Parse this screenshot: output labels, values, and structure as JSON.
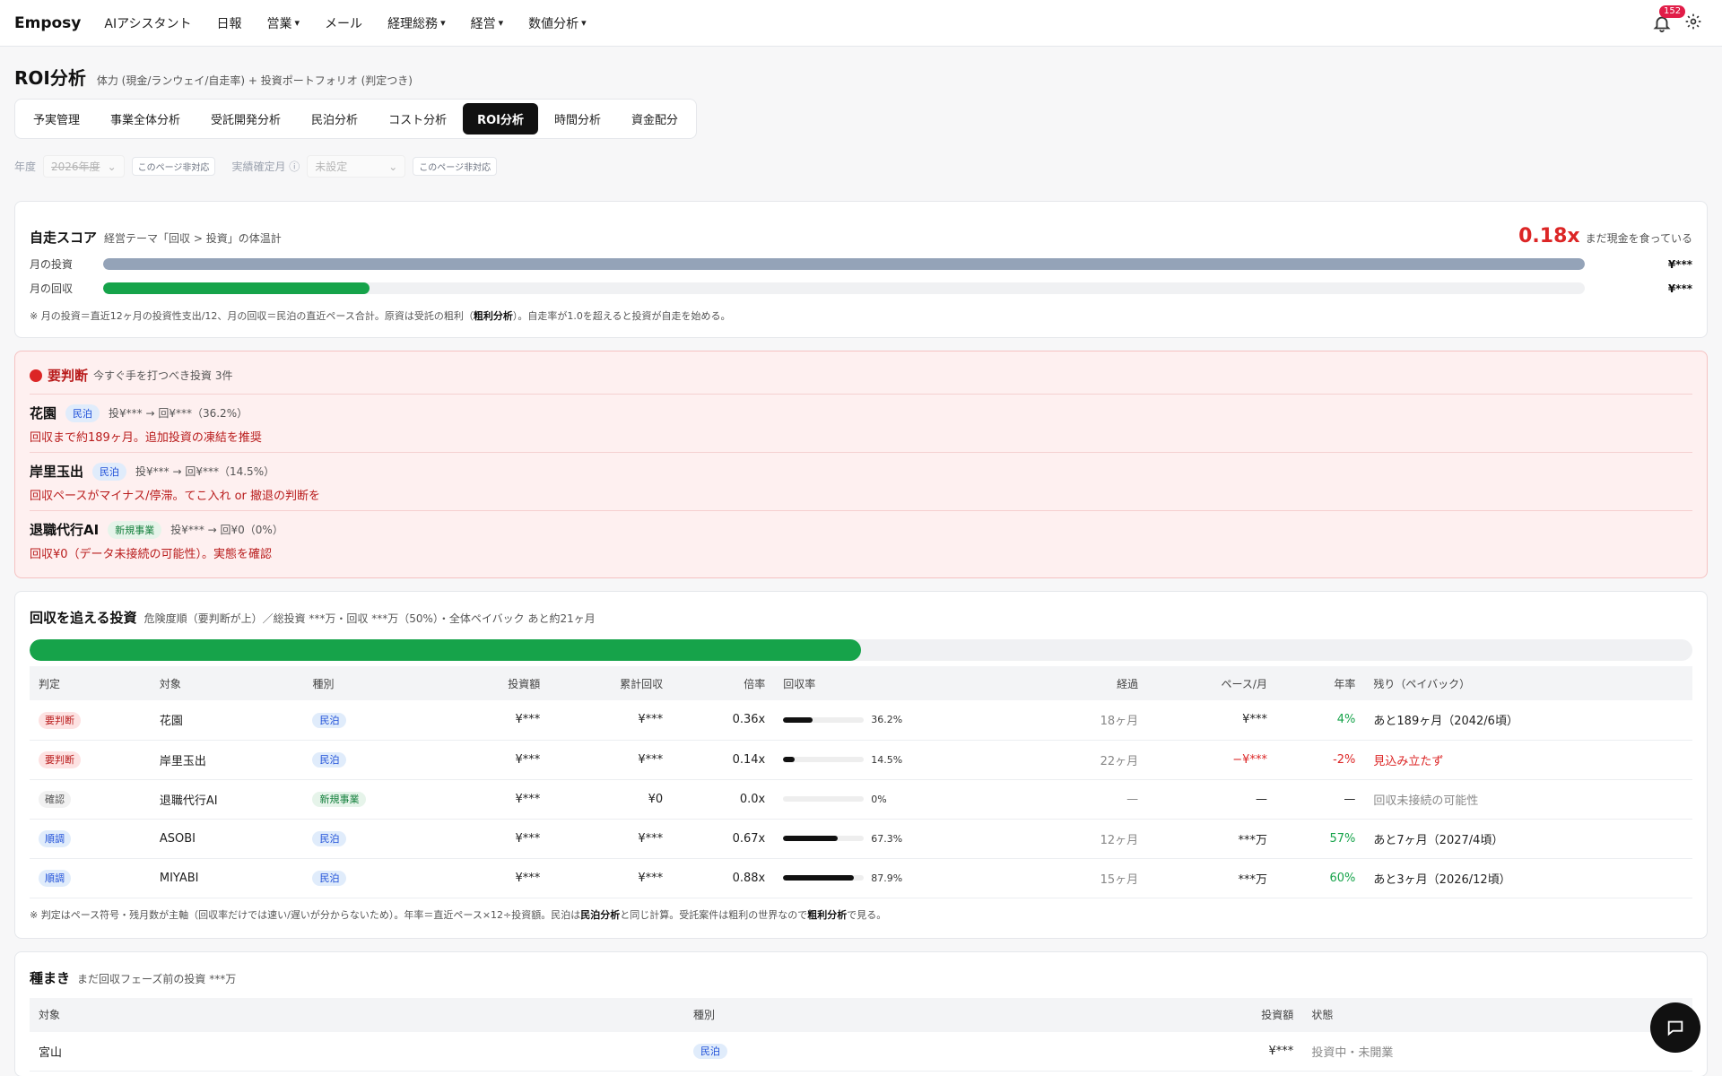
{
  "nav": {
    "brand": "Emposy",
    "items": [
      {
        "label": "AIアシスタント",
        "caret": ""
      },
      {
        "label": "日報",
        "caret": ""
      },
      {
        "label": "営業",
        "caret": "▾"
      },
      {
        "label": "メール",
        "caret": ""
      },
      {
        "label": "経理総務",
        "caret": "▾"
      },
      {
        "label": "経営",
        "caret": "▾"
      },
      {
        "label": "数値分析",
        "caret": "▾"
      }
    ],
    "notifications": "152"
  },
  "header": {
    "title": "ROI分析",
    "subtitle": "体力 (現金/ランウェイ/自走率) + 投資ポートフォリオ (判定つき)"
  },
  "tabs": [
    "予実管理",
    "事業全体分析",
    "受託開発分析",
    "民泊分析",
    "コスト分析",
    "ROI分析",
    "時間分析",
    "資金配分"
  ],
  "active_tab_index": 5,
  "filters": {
    "year_label": "年度",
    "year_value": "2026年度",
    "year_chip": "このページ非対応",
    "confirm_label": "実績確定月",
    "confirm_info": "ⓘ",
    "confirm_value": "未設定",
    "confirm_chip": "このページ非対応"
  },
  "self_score": {
    "title": "自走スコア",
    "subtitle": "経営テーマ「回収 > 投資」の体温計",
    "value": "0.18x",
    "value_label": "まだ現金を食っている",
    "rows": [
      {
        "label": "月の投資",
        "amount": "¥***",
        "fraction": 1.0,
        "color": "#94a3b8"
      },
      {
        "label": "月の回収",
        "amount": "¥***",
        "fraction": 0.18,
        "color": "#16a34a"
      }
    ],
    "note_pre": "※ 月の投資＝直近12ヶ月の投資性支出/12、月の回収＝民泊の直近ペース合計。原資は受託の粗利（",
    "note_bold": "粗利分析",
    "note_post": "）。自走率が1.0を超えると投資が自走を始める。"
  },
  "alert": {
    "title": "要判断",
    "subtitle": "今すぐ手を打つべき投資 3件",
    "items": [
      {
        "name": "花園",
        "tag": "民泊",
        "amount": "投¥*** → 回¥***（36.2%）",
        "message": "回収まで約189ヶ月。追加投資の凍結を推奨"
      },
      {
        "name": "岸里玉出",
        "tag": "民泊",
        "amount": "投¥*** → 回¥***（14.5%）",
        "message": "回収ペースがマイナス/停滞。てこ入れ or 撤退の判断を"
      },
      {
        "name": "退職代行AI",
        "tag": "新規事業",
        "amount": "投¥*** → 回¥0（0%）",
        "message": "回収¥0（データ未接続の可能性）。実態を確認"
      }
    ]
  },
  "recovery": {
    "title": "回収を追える投資",
    "subtitle": "危険度順（要判断が上）／総投資 ***万・回収 ***万（50%）・全体ペイバック あと約21ヶ月",
    "progress": 0.5,
    "columns": [
      "判定",
      "対象",
      "種別",
      "投資額",
      "累計回収",
      "倍率",
      "回収率",
      "経過",
      "ペース/月",
      "年率",
      "残り（ペイバック）"
    ],
    "rows": [
      {
        "judge": "要判断",
        "judge_style": "red",
        "target": "花園",
        "type": "民泊",
        "invest": "¥***",
        "recovered": "¥***",
        "multiple": "0.36x",
        "rate": 0.362,
        "rate_label": "36.2%",
        "elapsed": "18ヶ月",
        "pace": "¥***",
        "pace_style": "",
        "annual": "4%",
        "annual_style": "pos",
        "remaining": "あと189ヶ月（2042/6頃）",
        "remaining_style": ""
      },
      {
        "judge": "要判断",
        "judge_style": "red",
        "target": "岸里玉出",
        "type": "民泊",
        "invest": "¥***",
        "recovered": "¥***",
        "multiple": "0.14x",
        "rate": 0.145,
        "rate_label": "14.5%",
        "elapsed": "22ヶ月",
        "pace": "−¥***",
        "pace_style": "neg",
        "annual": "-2%",
        "annual_style": "neg",
        "remaining": "見込み立たず",
        "remaining_style": "neg"
      },
      {
        "judge": "確認",
        "judge_style": "gray",
        "target": "退職代行AI",
        "type": "新規事業",
        "invest": "¥***",
        "recovered": "¥0",
        "multiple": "0.0x",
        "rate": 0,
        "rate_label": "0%",
        "elapsed": "—",
        "pace": "—",
        "pace_style": "",
        "annual": "—",
        "annual_style": "",
        "remaining": "回収未接続の可能性",
        "remaining_style": "muted"
      },
      {
        "judge": "順調",
        "judge_style": "blue",
        "target": "ASOBI",
        "type": "民泊",
        "invest": "¥***",
        "recovered": "¥***",
        "multiple": "0.67x",
        "rate": 0.673,
        "rate_label": "67.3%",
        "elapsed": "12ヶ月",
        "pace": "***万",
        "pace_style": "",
        "annual": "57%",
        "annual_style": "pos",
        "remaining": "あと7ヶ月（2027/4頃）",
        "remaining_style": ""
      },
      {
        "judge": "順調",
        "judge_style": "blue",
        "target": "MIYABI",
        "type": "民泊",
        "invest": "¥***",
        "recovered": "¥***",
        "multiple": "0.88x",
        "rate": 0.879,
        "rate_label": "87.9%",
        "elapsed": "15ヶ月",
        "pace": "***万",
        "pace_style": "",
        "annual": "60%",
        "annual_style": "pos",
        "remaining": "あと3ヶ月（2026/12頃）",
        "remaining_style": ""
      }
    ],
    "note_1": "※ 判定はペース符号・残月数が主軸（回収率だけでは速い/遅いが分からないため）。年率＝直近ペース×12÷投資額。民泊は",
    "note_bold_1": "民泊分析",
    "note_2": "と同じ計算。受託案件は粗利の世界なので",
    "note_bold_2": "粗利分析",
    "note_3": "で見る。"
  },
  "seeding": {
    "title": "種まき",
    "subtitle": "まだ回収フェーズ前の投資 ***万",
    "columns": [
      "対象",
      "種別",
      "投資額",
      "状態"
    ],
    "rows": [
      {
        "target": "宮山",
        "type": "民泊",
        "invest": "¥***",
        "status": "投資中・未開業"
      }
    ]
  }
}
